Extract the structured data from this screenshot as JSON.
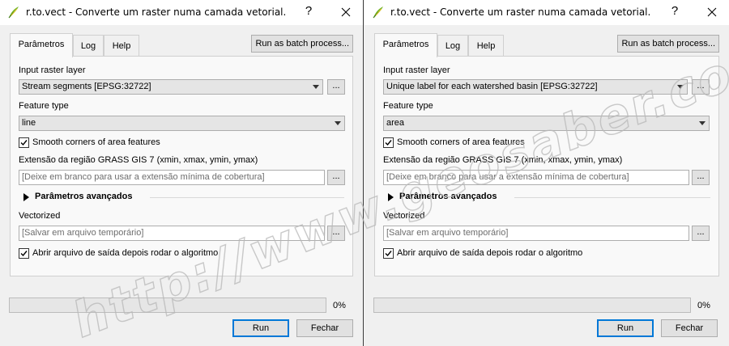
{
  "dialogs": [
    {
      "title": "r.to.vect - Converte um raster numa camada vetorial.",
      "help_glyph": "?",
      "tabs": [
        "Parâmetros",
        "Log",
        "Help"
      ],
      "active_tab": 0,
      "batch_button": "Run as batch process...",
      "input_raster_label": "Input raster layer",
      "input_raster_value": "Stream segments [EPSG:32722]",
      "feature_type_label": "Feature type",
      "feature_type_value": "line",
      "smooth_corners": {
        "label": "Smooth corners of area features",
        "checked": true
      },
      "extent_label": "Extensão da região GRASS GIS 7 (xmin, xmax, ymin, ymax)",
      "extent_placeholder": "[Deixe em branco para usar a extensão mínima de cobertura]",
      "advanced_label": "Parâmetros avançados",
      "vectorized_label": "Vectorized",
      "vectorized_placeholder": "[Salvar em arquivo temporário]",
      "open_output": {
        "label": "Abrir arquivo de saída depois rodar o algoritmo",
        "checked": true
      },
      "browse_label": "...",
      "progress_percent": "0%",
      "progress_value": 0,
      "run_button": "Run",
      "close_button": "Fechar"
    },
    {
      "title": "r.to.vect - Converte um raster numa camada vetorial.",
      "help_glyph": "?",
      "tabs": [
        "Parâmetros",
        "Log",
        "Help"
      ],
      "active_tab": 0,
      "batch_button": "Run as batch process...",
      "input_raster_label": "Input raster layer",
      "input_raster_value": "Unique label for each watershed basin [EPSG:32722]",
      "feature_type_label": "Feature type",
      "feature_type_value": "area",
      "smooth_corners": {
        "label": "Smooth corners of area features",
        "checked": true
      },
      "extent_label": "Extensão da região GRASS GIS 7 (xmin, xmax, ymin, ymax)",
      "extent_placeholder": "[Deixe em branco para usar a extensão mínima de cobertura]",
      "advanced_label": "Parâmetros avançados",
      "vectorized_label": "Vectorized",
      "vectorized_placeholder": "[Salvar em arquivo temporário]",
      "open_output": {
        "label": "Abrir arquivo de saída depois rodar o algoritmo",
        "checked": true
      },
      "browse_label": "...",
      "progress_percent": "0%",
      "progress_value": 0,
      "run_button": "Run",
      "close_button": "Fechar"
    }
  ],
  "watermark": "http://www.geosaber.com.br",
  "icons": {
    "app": "qgis-icon",
    "close": "close-icon",
    "help": "help-icon",
    "dropdown": "chevron-down-icon",
    "expand": "triangle-right-icon",
    "check": "check-icon"
  },
  "colors": {
    "run_focus": "#0078d7",
    "watermark": "#b8b8b8"
  }
}
